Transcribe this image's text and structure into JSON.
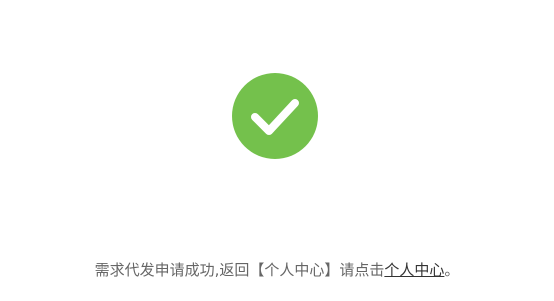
{
  "status": {
    "icon": "success-check-icon",
    "icon_color": "#74c14c"
  },
  "message": {
    "text": "需求代发申请成功,返回【个人中心】请点击",
    "link_label": "个人中心",
    "suffix": "。"
  }
}
